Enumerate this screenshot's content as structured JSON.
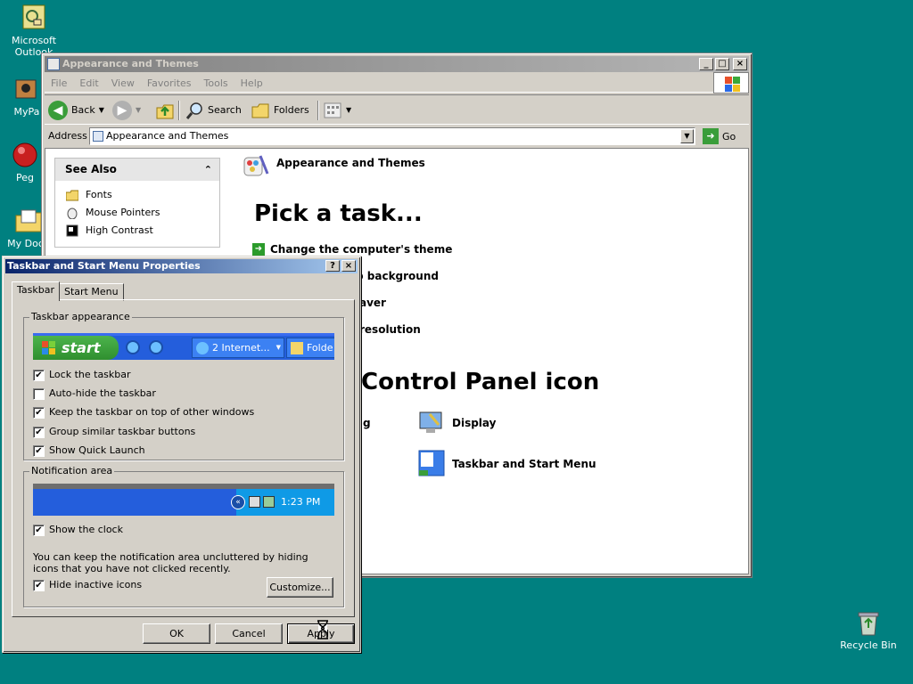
{
  "desktop": {
    "icons": [
      {
        "label": "Microsoft\nOutlook",
        "icon": "outlook-icon"
      },
      {
        "label": "MyPa",
        "icon": "mypictures-icon"
      },
      {
        "label": "Peg",
        "icon": "pegasus-icon"
      },
      {
        "label": "My Docu",
        "icon": "my-documents-icon"
      },
      {
        "label": "Recycle Bin",
        "icon": "recycle-bin-icon"
      }
    ]
  },
  "explorer": {
    "title": "Appearance and Themes",
    "menu": [
      "File",
      "Edit",
      "View",
      "Favorites",
      "Tools",
      "Help"
    ],
    "toolbar": {
      "back": "Back",
      "search": "Search",
      "folders": "Folders"
    },
    "address": {
      "label": "Address",
      "value": "Appearance and Themes",
      "go": "Go"
    },
    "see_also": {
      "title": "See Also",
      "items": [
        "Fonts",
        "Mouse Pointers",
        "High Contrast"
      ]
    },
    "heading": "Appearance and Themes",
    "pick_task": "Pick a task...",
    "tasks": [
      "Change the computer's theme",
      "p background",
      "aver",
      " resolution"
    ],
    "pick_icon": "Control Panel icon",
    "cp_items": [
      "g",
      "Display",
      "Taskbar and Start Menu"
    ]
  },
  "dialog": {
    "title": "Taskbar and Start Menu Properties",
    "help": "?",
    "close": "×",
    "tabs": [
      "Taskbar",
      "Start Menu"
    ],
    "taskbar_group": "Taskbar appearance",
    "preview": {
      "start": "start",
      "task1": "2 Internet...",
      "task2": "Folde"
    },
    "options": [
      {
        "label": "Lock the taskbar",
        "checked": "✔"
      },
      {
        "label": "Auto-hide the taskbar",
        "checked": ""
      },
      {
        "label": "Keep the taskbar on top of other windows",
        "checked": "✔"
      },
      {
        "label": "Group similar taskbar buttons",
        "checked": "✔"
      },
      {
        "label": "Show Quick Launch",
        "checked": "✔"
      }
    ],
    "notif_group": "Notification area",
    "clock": "1:23 PM",
    "show_clock": {
      "label": "Show the clock",
      "checked": "✔"
    },
    "note": "You can keep the notification area uncluttered by hiding icons that you have not clicked recently.",
    "hide_inactive": {
      "label": "Hide inactive icons",
      "checked": "✔"
    },
    "customize": "Customize...",
    "ok": "OK",
    "cancel": "Cancel",
    "apply": "Apply"
  },
  "colors": {
    "desktop": "#008080",
    "dialog_title": "#0a246a",
    "xp_taskbar": "#245edc",
    "xp_start": "#3a9d3a"
  }
}
